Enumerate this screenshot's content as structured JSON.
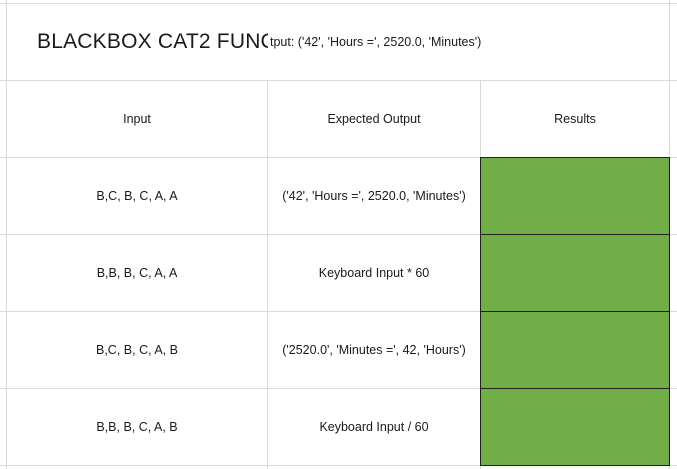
{
  "sheet": {
    "title": "BLACKBOX CAT2 FUNC",
    "title_output": "tput: ('42', 'Hours =', 2520.0, 'Minutes')",
    "headers": {
      "input": "Input",
      "expected": "Expected Output",
      "results": "Results"
    },
    "rows": [
      {
        "input": "B,C, B, C, A, A",
        "expected": "('42', 'Hours =', 2520.0, 'Minutes')",
        "result_status": "pass"
      },
      {
        "input": "B,B, B, C, A, A",
        "expected": "Keyboard Input * 60",
        "result_status": "pass"
      },
      {
        "input": "B,C, B, C, A, B",
        "expected": "('2520.0', 'Minutes =', 42, 'Hours')",
        "result_status": "pass"
      },
      {
        "input": "B,B, B, C, A, B",
        "expected": "Keyboard Input / 60",
        "result_status": "pass"
      }
    ]
  },
  "colors": {
    "pass_fill": "#70ad47",
    "gridline": "#d9d9d9",
    "result_border": "#1f1f1f"
  }
}
